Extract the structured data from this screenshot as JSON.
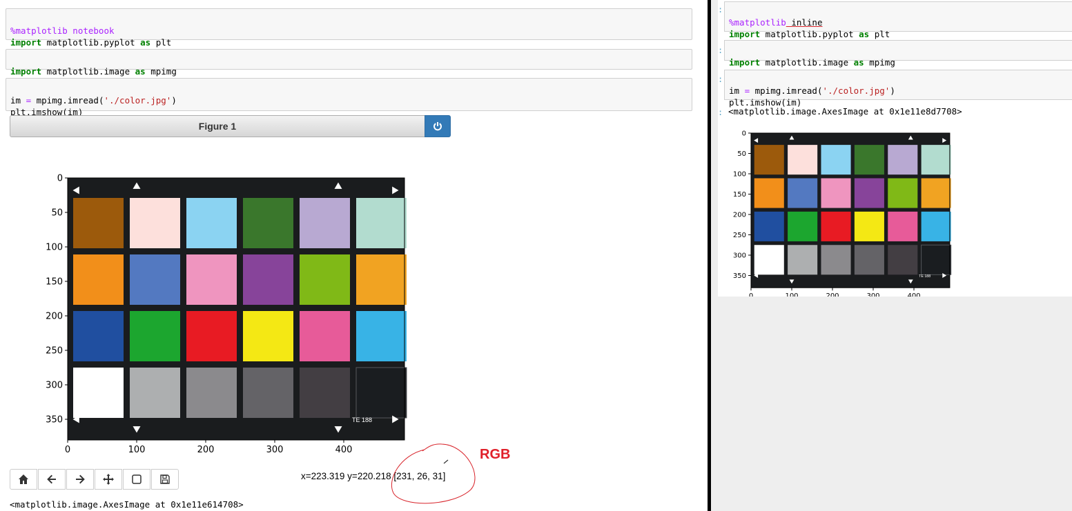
{
  "left": {
    "cell1": {
      "magic": "%matplotlib notebook",
      "line2_kw": "import",
      "line2_mod": " matplotlib.pyplot ",
      "line2_as": "as",
      "line2_alias": " plt"
    },
    "cell2": {
      "kw": "import",
      "mod": " matplotlib.image ",
      "as": "as",
      "alias": " mpimg"
    },
    "cell3": {
      "l1_pre": "im ",
      "l1_eq": "=",
      "l1_call": " mpimg.imread(",
      "l1_str": "'./color.jpg'",
      "l1_end": ")",
      "l2": "plt.imshow(im)"
    },
    "figure_title": "Figure 1",
    "status": "x=223.319 y=220.218 [231, 26, 31]",
    "output": "<matplotlib.image.AxesImage at 0x1e11e614708>",
    "annotation": "RGB",
    "toolbar": [
      "home-icon",
      "back-icon",
      "forward-icon",
      "pan-icon",
      "zoom-rect-icon",
      "save-icon"
    ]
  },
  "right": {
    "cell1": {
      "magic_pct": "%matplotlib",
      "magic_arg": " inline",
      "line2_kw": "import",
      "line2_mod": " matplotlib.pyplot ",
      "line2_as": "as",
      "line2_alias": " plt"
    },
    "cell2": {
      "kw": "import",
      "mod": " matplotlib.image ",
      "as": "as",
      "alias": " mpimg"
    },
    "cell3": {
      "l1_pre": "im ",
      "l1_eq": "=",
      "l1_call": " mpimg.imread(",
      "l1_str": "'./color.jpg'",
      "l1_end": ")",
      "l2": "plt.imshow(im)"
    },
    "output": "<matplotlib.image.AxesImage at 0x1e11e8d7708>"
  },
  "plot": {
    "y_ticks": [
      "0",
      "50",
      "100",
      "150",
      "200",
      "250",
      "300",
      "350"
    ],
    "x_ticks": [
      "0",
      "100",
      "200",
      "300",
      "400"
    ],
    "label_te": "TE 188",
    "swatches": [
      [
        "#9c5a0c",
        "#fde0dc",
        "#8bd3f2",
        "#3a772c",
        "#b8a9d2",
        "#b2dccf"
      ],
      [
        "#f28f1a",
        "#5379c1",
        "#ef95bf",
        "#87449a",
        "#80b917",
        "#f1a322"
      ],
      [
        "#204fa0",
        "#1ca62f",
        "#e81b23",
        "#f4e814",
        "#e75b99",
        "#38b3e6"
      ],
      [
        "#ffffff",
        "#adafb0",
        "#8b8a8d",
        "#646367",
        "#433e43",
        "#1a1d20"
      ]
    ]
  }
}
